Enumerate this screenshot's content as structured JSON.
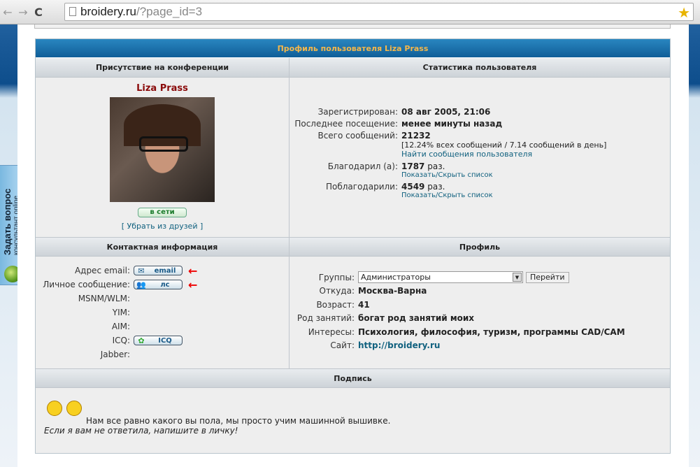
{
  "browser": {
    "url_host": "broidery.ru",
    "url_path": "/?page_id=3"
  },
  "side_widget": {
    "title": "Задать вопрос",
    "subtitle": "консультант online"
  },
  "profile": {
    "title": "Профиль пользователя Liza Prass",
    "headers": {
      "presence": "Присутствие на конференции",
      "stats": "Статистика пользователя",
      "contact": "Контактная информация",
      "profile": "Профиль",
      "signature": "Подпись"
    },
    "username": "Liza Prass",
    "online_label": "в сети",
    "remove_friend": "[ Убрать из друзей ]",
    "stats": [
      {
        "label": "Зарегистрирован:",
        "value": "08 авг 2005, 21:06"
      },
      {
        "label": "Последнее посещение:",
        "value": "менее минуты назад"
      },
      {
        "label": "Всего сообщений:",
        "value": "21232",
        "note": "[12.24% всех сообщений / 7.14 сообщений в день]",
        "link": "Найти сообщения пользователя"
      },
      {
        "label": "Благодарил (а):",
        "value": "1787",
        "suffix": " раз.",
        "link": "Показать/Скрыть список"
      },
      {
        "label": "Поблагодарили:",
        "value": "4549",
        "suffix": " раз.",
        "link": "Показать/Скрыть список"
      }
    ],
    "contact": [
      {
        "label": "Адрес email:",
        "button": "email"
      },
      {
        "label": "Личное сообщение:",
        "button": "лс"
      },
      {
        "label": "MSNM/WLM:"
      },
      {
        "label": "YIM:"
      },
      {
        "label": "AIM:"
      },
      {
        "label": "ICQ:",
        "button": "ICQ"
      },
      {
        "label": "Jabber:"
      }
    ],
    "details": {
      "groups_label": "Группы:",
      "groups_value": "Администраторы",
      "go_button": "Перейти",
      "rows": [
        {
          "label": "Откуда:",
          "value": "Москва-Варна"
        },
        {
          "label": "Возраст:",
          "value": "41"
        },
        {
          "label": "Род занятий:",
          "value": "богат род занятий моих"
        },
        {
          "label": "Интересы:",
          "value": "Психология, философия, туризм, программы CAD/CAM"
        },
        {
          "label": "Сайт:",
          "value": "http://broidery.ru"
        }
      ]
    },
    "signature": {
      "line1": "Нам все равно какого вы пола, мы просто учим машинной вышивке.",
      "line2": "Если я вам не ответила, напишите в личку!"
    }
  }
}
